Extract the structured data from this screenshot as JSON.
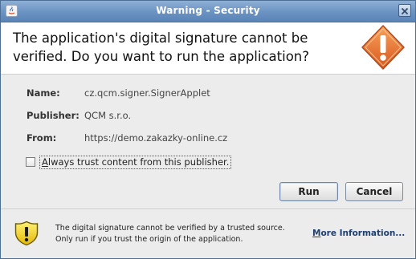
{
  "window": {
    "title": "Warning - Security"
  },
  "header": {
    "line1": "The application's digital signature cannot be",
    "line2": "verified.  Do you want to run the application?",
    "icon": "warning-diamond-icon",
    "icon_color": "#e8742b"
  },
  "details": {
    "rows": [
      {
        "label": "Name:",
        "value": "cz.qcm.signer.SignerApplet"
      },
      {
        "label": "Publisher:",
        "value": "QCM s.r.o."
      },
      {
        "label": "From:",
        "value": "https://demo.zakazky-online.cz"
      }
    ]
  },
  "trust": {
    "checked": false,
    "label_first": "A",
    "label_rest": "lways trust content from this publisher."
  },
  "buttons": {
    "run": "Run",
    "cancel": "Cancel"
  },
  "footer": {
    "icon": "warning-shield-icon",
    "line1": "The digital signature cannot be verified by a trusted source.",
    "line2": "Only run if you trust the origin of the application.",
    "more_first": "M",
    "more_rest": "ore Information..."
  }
}
